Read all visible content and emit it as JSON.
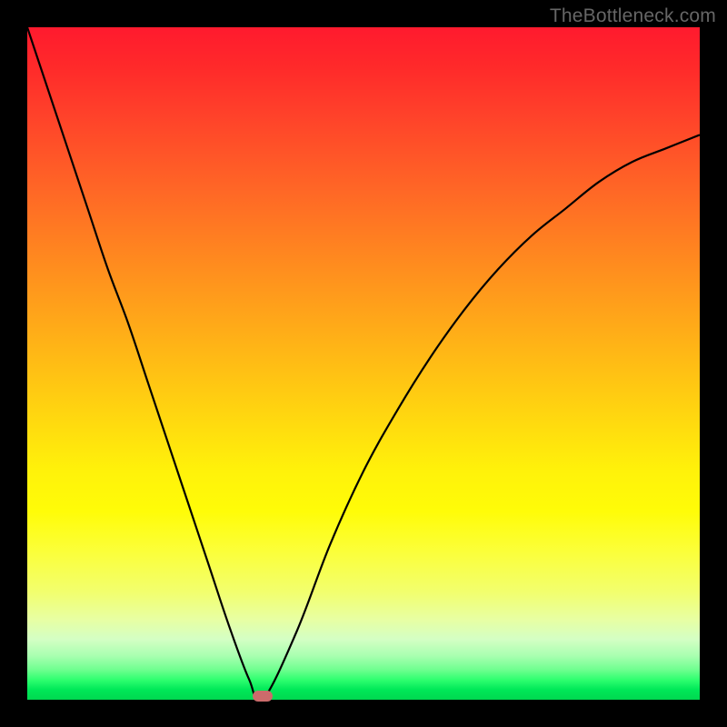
{
  "watermark": "TheBottleneck.com",
  "chart_data": {
    "type": "line",
    "title": "",
    "xlabel": "",
    "ylabel": "",
    "xlim": [
      0,
      100
    ],
    "ylim": [
      0,
      100
    ],
    "x": [
      0,
      3,
      6,
      9,
      12,
      15,
      18,
      21,
      24,
      27,
      30,
      33,
      35,
      40,
      45,
      50,
      55,
      60,
      65,
      70,
      75,
      80,
      85,
      90,
      95,
      100
    ],
    "values": [
      100,
      91,
      82,
      73,
      64,
      56,
      47,
      38,
      29,
      20,
      11,
      3,
      0,
      10,
      23,
      34,
      43,
      51,
      58,
      64,
      69,
      73,
      77,
      80,
      82,
      84
    ],
    "minimum": {
      "x": 35,
      "y": 0
    },
    "background_gradient": {
      "top": "#ff1a2e",
      "mid": "#ffe600",
      "bottom": "#00d850"
    }
  },
  "marker": {
    "x_pct": 35,
    "y_pct": 0
  }
}
